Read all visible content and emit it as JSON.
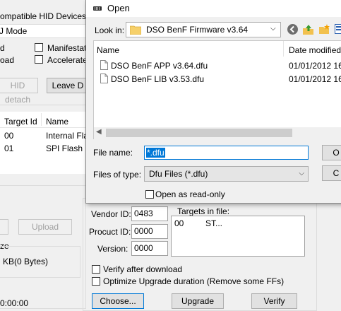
{
  "main": {
    "title_fragment": "ompatible HID Devices",
    "mode_label": "J Mode",
    "opt_left1": "d",
    "opt_left2": "oad",
    "opt_manifestation": "Manifestatio",
    "opt_accelerated": "Accelerated",
    "hid_detach": "HID detach",
    "leave_dfu": "Leave D",
    "table": {
      "col_target_id": "Target Id",
      "col_name": "Name",
      "rows": [
        {
          "id": "00",
          "name": "Internal Flas"
        },
        {
          "id": "01",
          "name": "SPI Flash : N"
        }
      ]
    },
    "upload": "Upload",
    "size_label": "ze",
    "size_value": "KB(0 Bytes)",
    "time_value": "0:00:00",
    "vendor_label": "Vendor ID:",
    "vendor_value": "0483",
    "procuct_label": "Procuct ID:",
    "procuct_value": "0000",
    "version_label": "Version:",
    "version_value": "0000",
    "targets_label": "Targets in file:",
    "targets_row": {
      "id": "00",
      "name": "ST..."
    },
    "verify_after": "Verify after download",
    "optimize": "Optimize Upgrade duration (Remove some FFs)",
    "choose": "Choose...",
    "upgrade": "Upgrade",
    "verify": "Verify"
  },
  "dialog": {
    "title": "Open",
    "look_in_label": "Look in:",
    "look_in_value": "DSO BenF Firmware v3.64",
    "col_name": "Name",
    "col_date": "Date modified",
    "files": [
      {
        "name": "DSO BenF APP v3.64.dfu",
        "date": "01/01/2012 16:"
      },
      {
        "name": "DSO BenF LIB v3.53.dfu",
        "date": "01/01/2012 16:"
      }
    ],
    "file_name_label": "File name:",
    "file_name_value": "*.dfu",
    "files_of_type_label": "Files of type:",
    "files_of_type_value": "Dfu Files (*.dfu)",
    "read_only": "Open as read-only",
    "open_btn": "O",
    "cancel_btn": "C"
  }
}
